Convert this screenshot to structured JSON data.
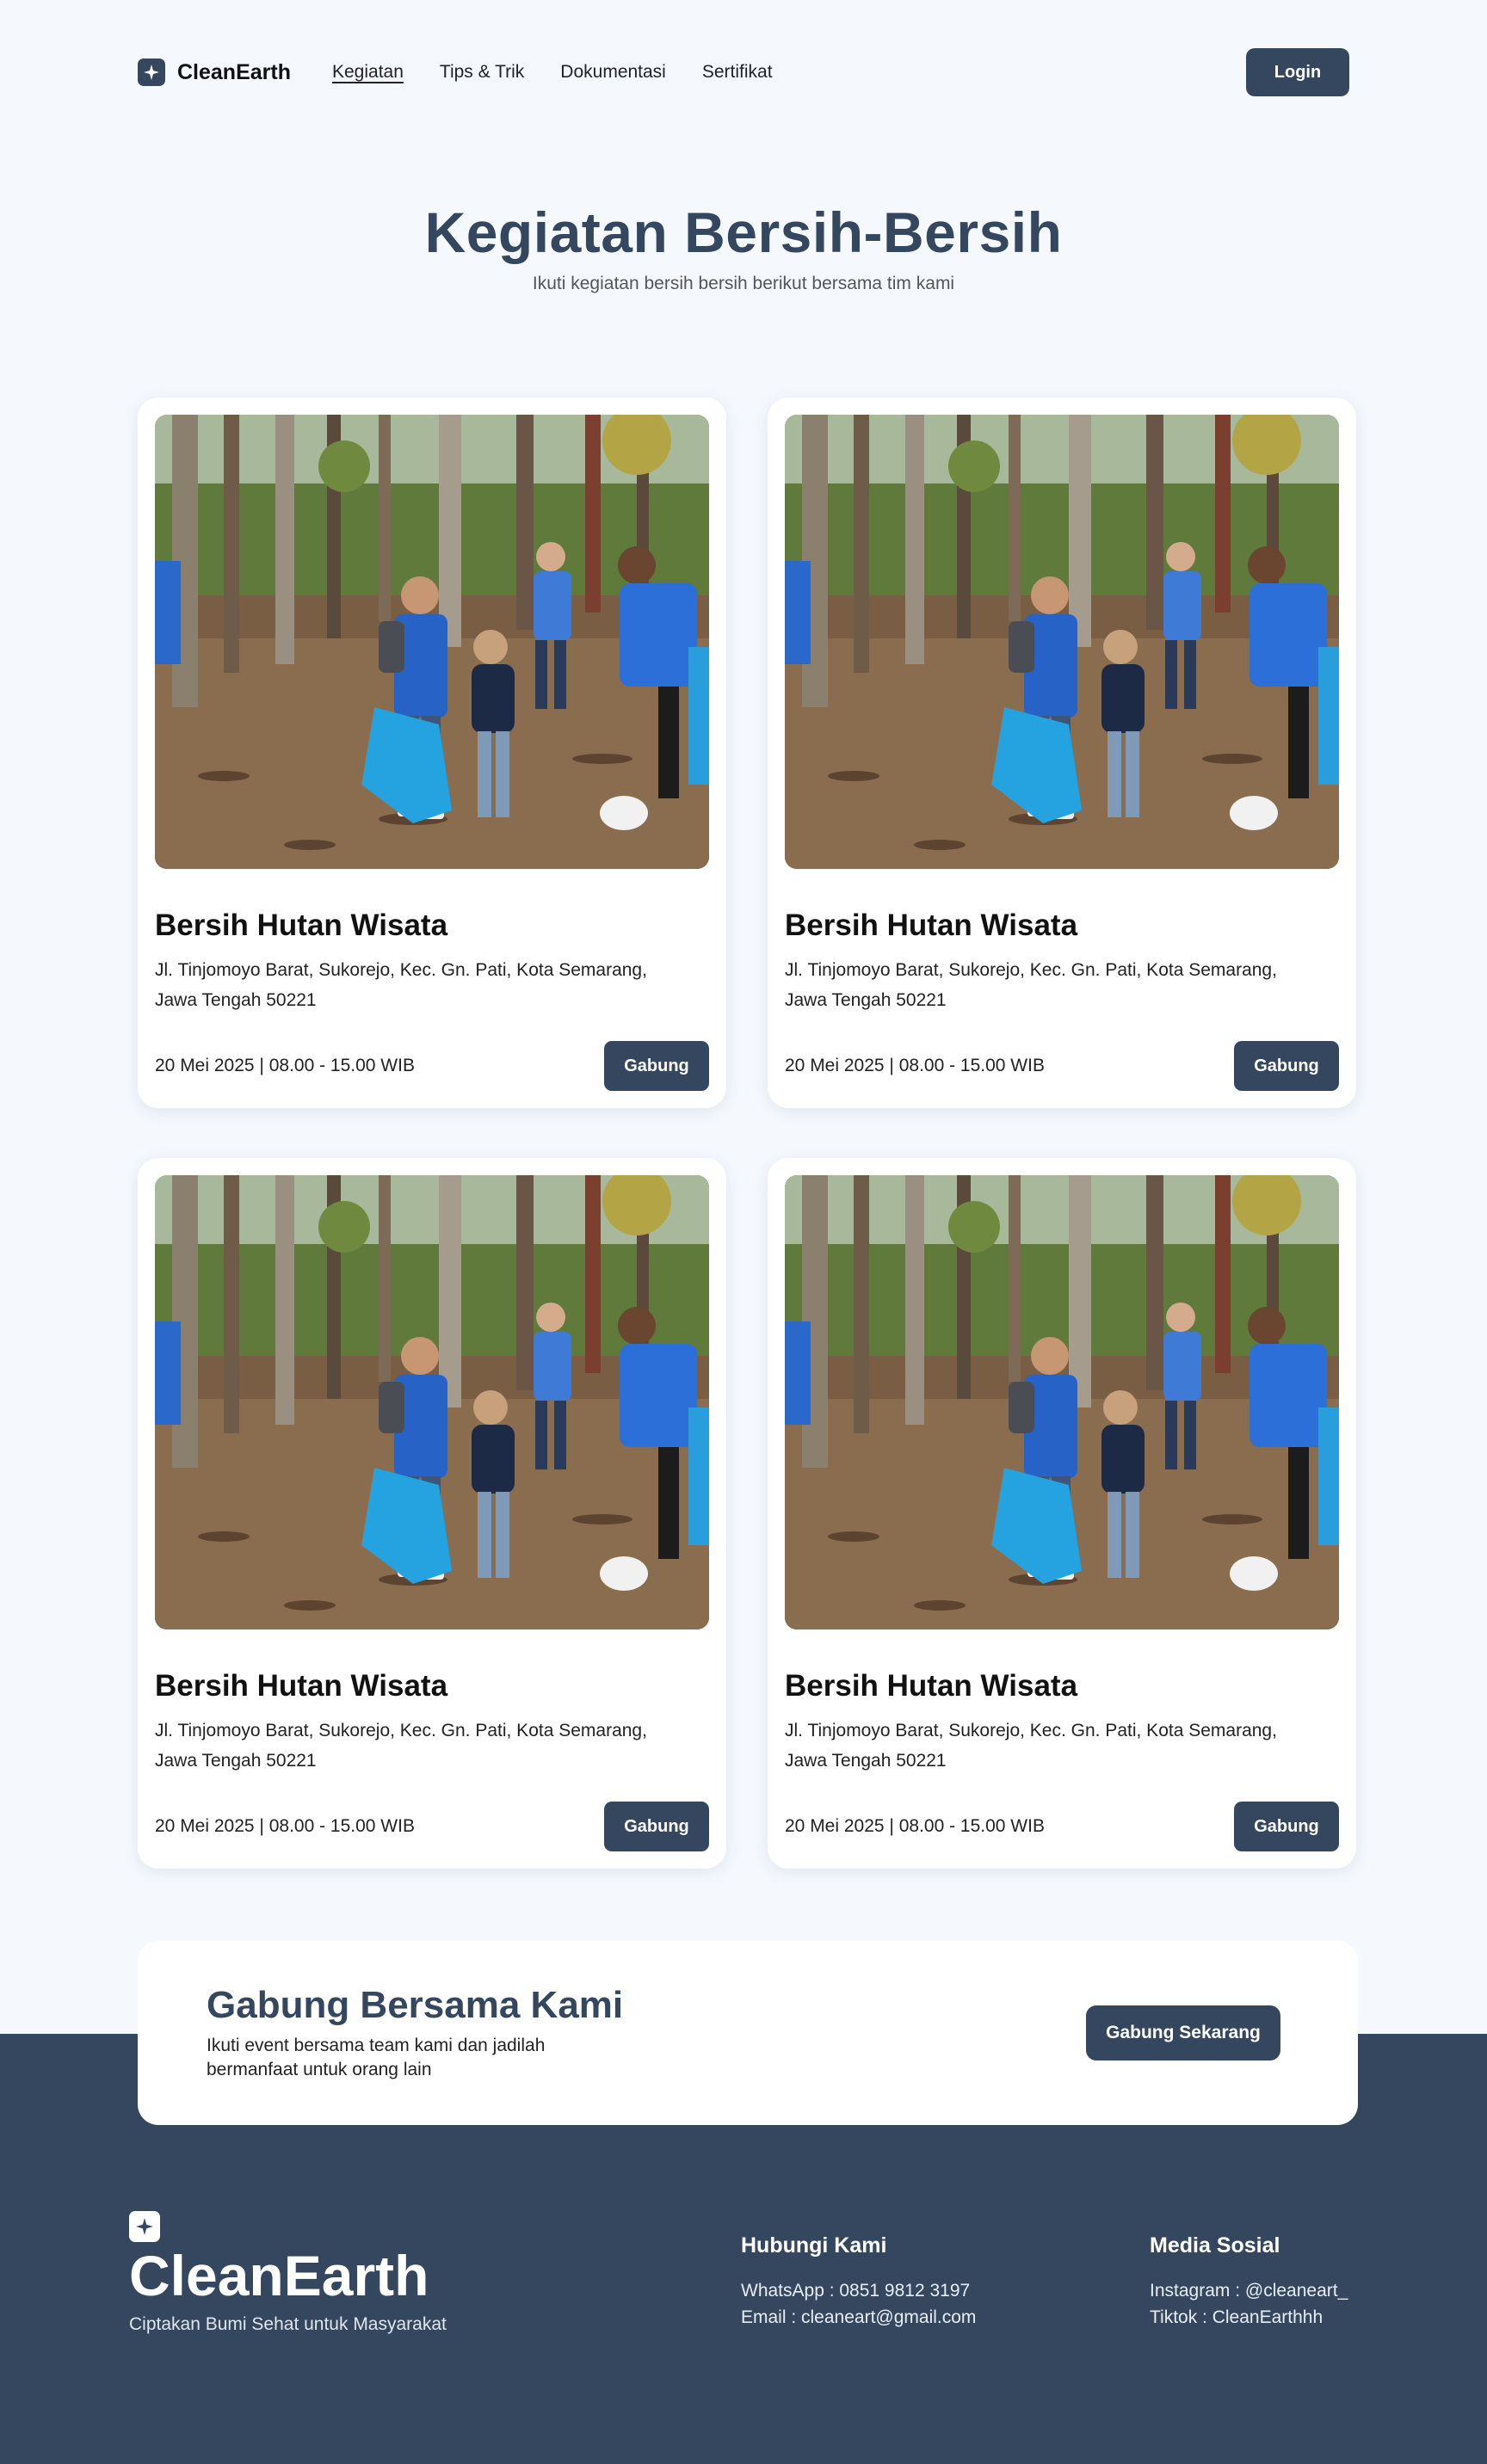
{
  "nav": {
    "brand": "CleanEarth",
    "links": [
      "Kegiatan",
      "Tips & Trik",
      "Dokumentasi",
      "Sertifikat"
    ],
    "active_link": "Kegiatan",
    "login_label": "Login"
  },
  "hero": {
    "title": "Kegiatan Bersih-Bersih",
    "subtitle": "Ikuti kegiatan bersih bersih berikut bersama tim kami"
  },
  "events": [
    {
      "title": "Bersih Hutan Wisata",
      "address": "Jl. Tinjomoyo Barat, Sukorejo, Kec. Gn. Pati, Kota Semarang, Jawa Tengah 50221",
      "datetime": "20 Mei 2025 | 08.00 - 15.00 WIB",
      "button": "Gabung"
    },
    {
      "title": "Bersih Hutan Wisata",
      "address": "Jl. Tinjomoyo Barat, Sukorejo, Kec. Gn. Pati, Kota Semarang, Jawa Tengah 50221",
      "datetime": "20 Mei 2025 | 08.00 - 15.00 WIB",
      "button": "Gabung"
    },
    {
      "title": "Bersih Hutan Wisata",
      "address": "Jl. Tinjomoyo Barat, Sukorejo, Kec. Gn. Pati, Kota Semarang, Jawa Tengah 50221",
      "datetime": "20 Mei 2025 | 08.00 - 15.00 WIB",
      "button": "Gabung"
    },
    {
      "title": "Bersih Hutan Wisata",
      "address": "Jl. Tinjomoyo Barat, Sukorejo, Kec. Gn. Pati, Kota Semarang, Jawa Tengah 50221",
      "datetime": "20 Mei 2025 | 08.00 - 15.00 WIB",
      "button": "Gabung"
    }
  ],
  "cta": {
    "title": "Gabung Bersama Kami",
    "text": "Ikuti event bersama team kami dan jadilah bermanfaat untuk orang lain",
    "button": "Gabung Sekarang"
  },
  "footer": {
    "brand": "CleanEarth",
    "tagline": "Ciptakan Bumi Sehat untuk Masyarakat",
    "contact": {
      "heading": "Hubungi Kami",
      "whatsapp": "WhatsApp : 0851 9812 3197",
      "email": "Email : cleaneart@gmail.com"
    },
    "social": {
      "heading": "Media Sosial",
      "instagram": "Instagram : @cleaneart_",
      "tiktok": "Tiktok : CleanEarthhh"
    }
  },
  "colors": {
    "primary": "#35475f",
    "background": "#f5f9fe",
    "card": "#ffffff"
  },
  "icons": {
    "brand": "sparkle-icon"
  }
}
